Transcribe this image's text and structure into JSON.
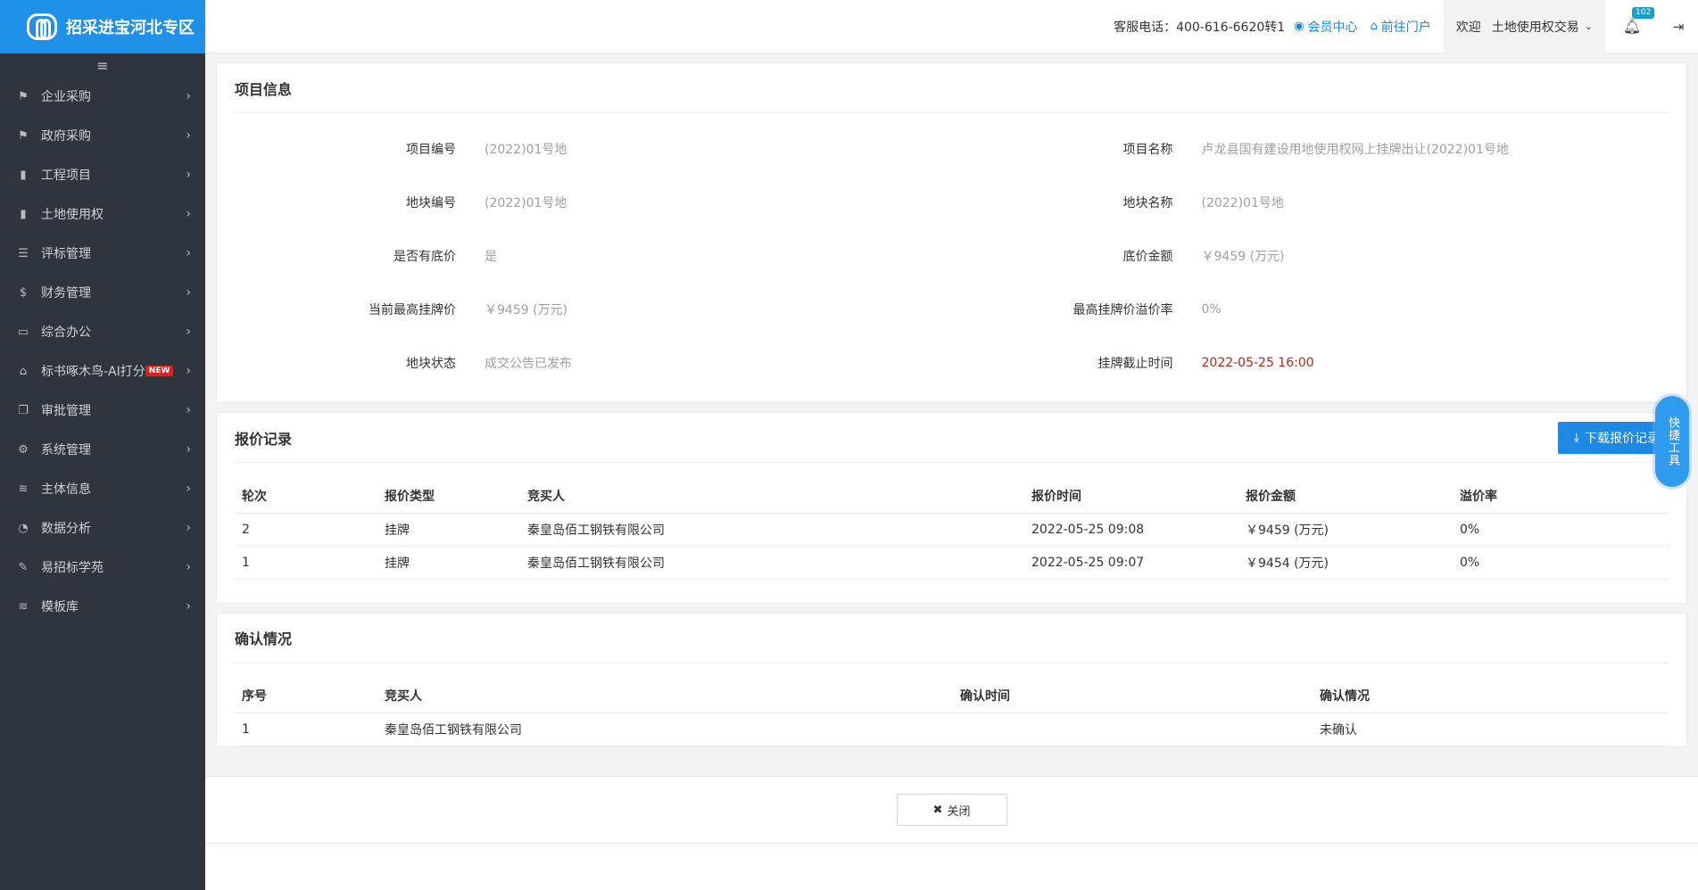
{
  "brand": {
    "title": "招采进宝河北专区"
  },
  "sidebar": {
    "collapse_icon": "≡",
    "items": [
      {
        "label": "企业采购",
        "icon": "flag-icon"
      },
      {
        "label": "政府采购",
        "icon": "flag-icon"
      },
      {
        "label": "工程项目",
        "icon": "building-icon"
      },
      {
        "label": "土地使用权",
        "icon": "building-icon"
      },
      {
        "label": "评标管理",
        "icon": "list-icon"
      },
      {
        "label": "财务管理",
        "icon": "dollar-icon"
      },
      {
        "label": "综合办公",
        "icon": "monitor-icon"
      },
      {
        "label": "标书啄木鸟-AI打分",
        "icon": "inbox-icon",
        "badge": "NEW"
      },
      {
        "label": "审批管理",
        "icon": "copy-icon"
      },
      {
        "label": "系统管理",
        "icon": "gears-icon"
      },
      {
        "label": "主体信息",
        "icon": "database-icon"
      },
      {
        "label": "数据分析",
        "icon": "pie-icon"
      },
      {
        "label": "易招标学苑",
        "icon": "edit-icon"
      },
      {
        "label": "模板库",
        "icon": "database-icon"
      }
    ]
  },
  "header": {
    "hotline": "客服电话：400-616-6620转1",
    "member_center": "会员中心",
    "portal": "前往门户",
    "welcome": "欢迎",
    "username": "土地使用权交易",
    "notification_count": "102"
  },
  "project_info": {
    "title": "项目信息",
    "fields": [
      {
        "label": "项目编号",
        "value": "(2022)01号地"
      },
      {
        "label": "项目名称",
        "value": "卢龙县国有建设用地使用权网上挂牌出让(2022)01号地"
      },
      {
        "label": "地块编号",
        "value": "(2022)01号地"
      },
      {
        "label": "地块名称",
        "value": "(2022)01号地"
      },
      {
        "label": "是否有底价",
        "value": "是"
      },
      {
        "label": "底价金额",
        "value": "￥9459 (万元)"
      },
      {
        "label": "当前最高挂牌价",
        "value": "￥9459 (万元)"
      },
      {
        "label": "最高挂牌价溢价率",
        "value": "0%"
      },
      {
        "label": "地块状态",
        "value": "成交公告已发布"
      },
      {
        "label": "挂牌截止时间",
        "value": "2022-05-25 16:00"
      }
    ]
  },
  "bid_records": {
    "title": "报价记录",
    "download_label": "下载报价记录",
    "columns": [
      "轮次",
      "报价类型",
      "竞买人",
      "报价时间",
      "报价金额",
      "溢价率"
    ],
    "rows": [
      [
        "2",
        "挂牌",
        "秦皇岛佰工钢铁有限公司",
        "2022-05-25 09:08",
        "￥9459 (万元)",
        "0%"
      ],
      [
        "1",
        "挂牌",
        "秦皇岛佰工钢铁有限公司",
        "2022-05-25 09:07",
        "￥9454 (万元)",
        "0%"
      ]
    ]
  },
  "confirmation": {
    "title": "确认情况",
    "columns": [
      "序号",
      "竞买人",
      "确认时间",
      "确认情况"
    ],
    "rows": [
      [
        "1",
        "秦皇岛佰工钢铁有限公司",
        "",
        "未确认"
      ]
    ]
  },
  "footer": {
    "close_label": "关闭"
  },
  "quick_tools": {
    "label": "快捷工具"
  }
}
